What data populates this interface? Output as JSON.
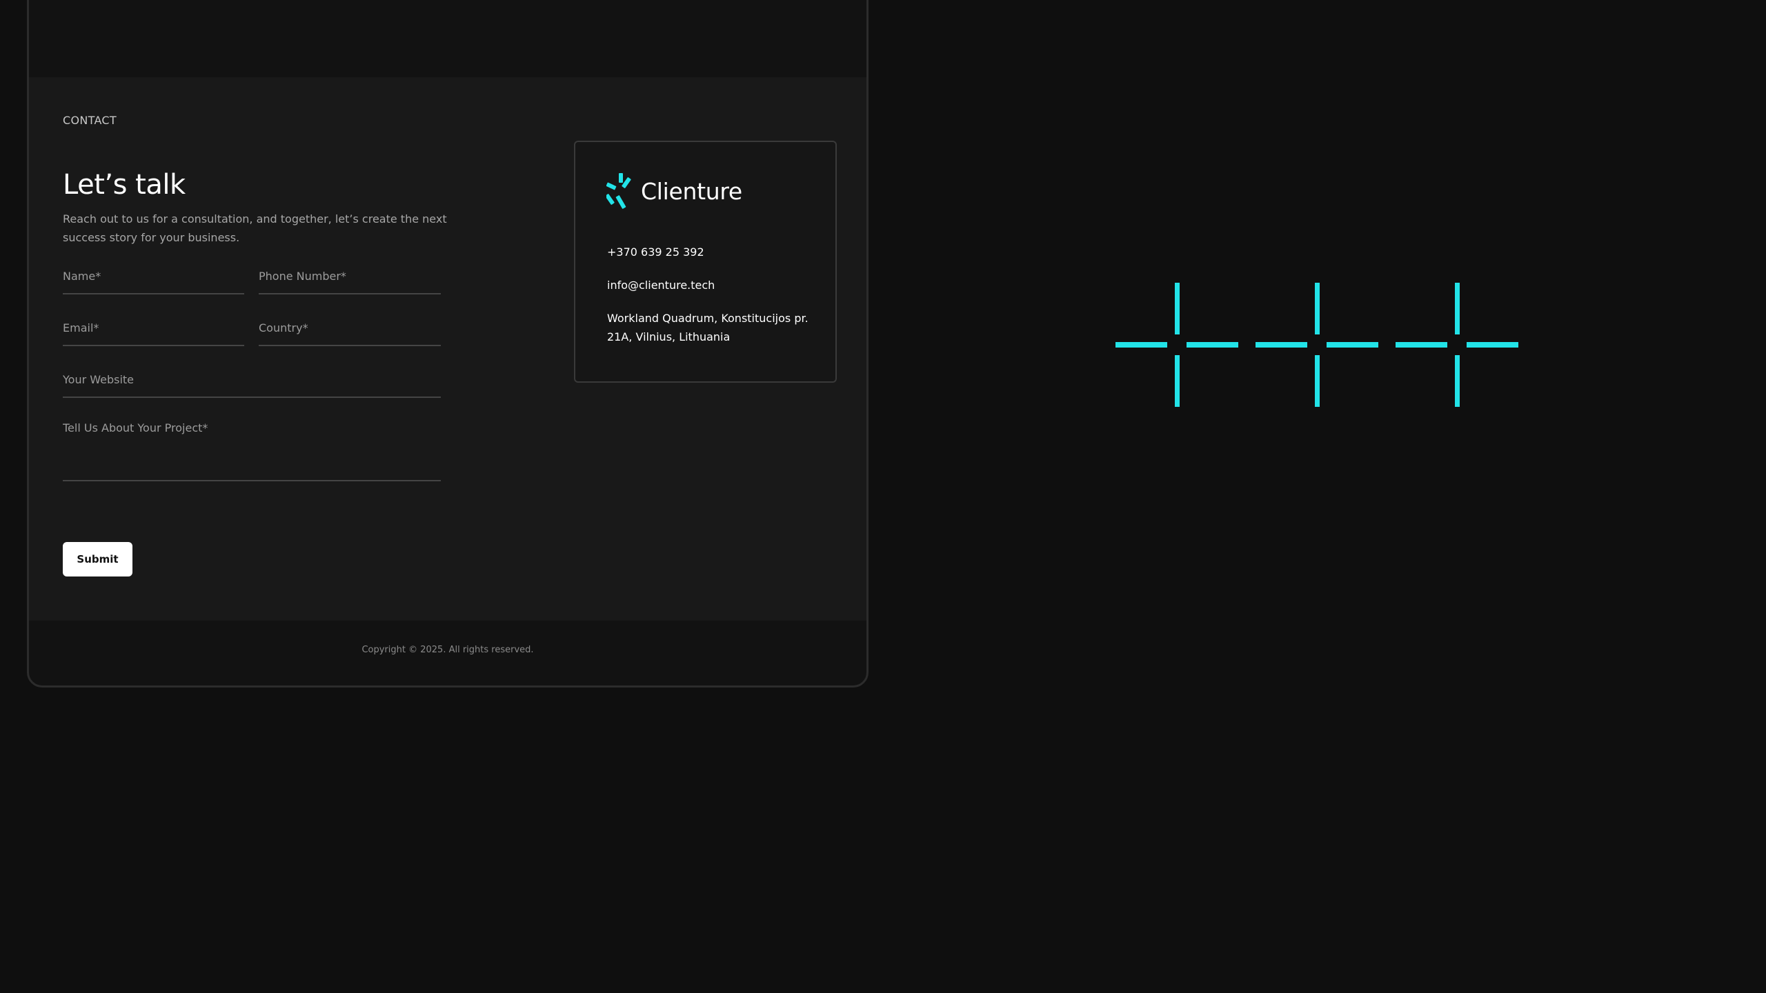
{
  "contact": {
    "eyebrow": "CONTACT",
    "title": "Let’s talk",
    "subtitle": "Reach out to us for a consultation, and together, let’s create the next success story for your business."
  },
  "form": {
    "name_placeholder": "Name*",
    "phone_placeholder": "Phone Number*",
    "email_placeholder": "Email*",
    "country_placeholder": "Country*",
    "website_placeholder": "Your Website",
    "project_placeholder": "Tell Us About Your Project*",
    "submit_label": "Submit"
  },
  "card": {
    "brand": "Clienture",
    "phone": "+370 639 25 392",
    "email": "info@clienture.tech",
    "address": "Workland Quadrum, Konstitucijos pr. 21A, Vilnius, Lithuania"
  },
  "footer": {
    "copyright": "Copyright © 2025. All rights reserved."
  },
  "colors": {
    "accent": "#22e3e8",
    "background": "#0f0f0f",
    "section": "#191919"
  }
}
